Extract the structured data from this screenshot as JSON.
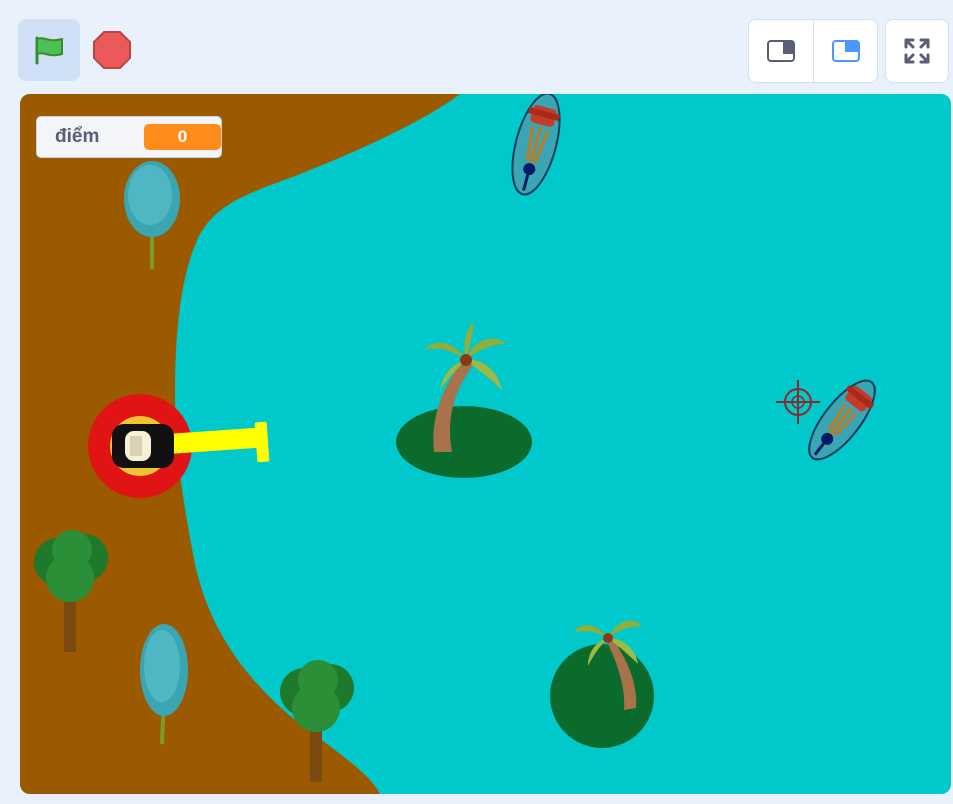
{
  "toolbar": {
    "green_flag": {
      "icon": "green-flag-icon",
      "active": true
    },
    "stop": {
      "icon": "stop-icon"
    },
    "layout_small": {
      "icon": "small-stage-icon"
    },
    "layout_normal": {
      "icon": "normal-stage-icon",
      "selected": true
    },
    "fullscreen": {
      "icon": "fullscreen-icon"
    }
  },
  "stage": {
    "monitor": {
      "label": "điểm",
      "value": "0"
    },
    "colors": {
      "water": "#00c8cb",
      "shore": "#9b5a00",
      "toolbar_bg": "#e9f1fc",
      "monitor_value": "#ff8c1a",
      "island": "#0b6b2c"
    },
    "sprites": [
      "cannon",
      "crosshair",
      "boat",
      "boat",
      "palm-island",
      "palm-island",
      "tree-blue",
      "tree-blue",
      "tree-green",
      "tree-green"
    ]
  }
}
